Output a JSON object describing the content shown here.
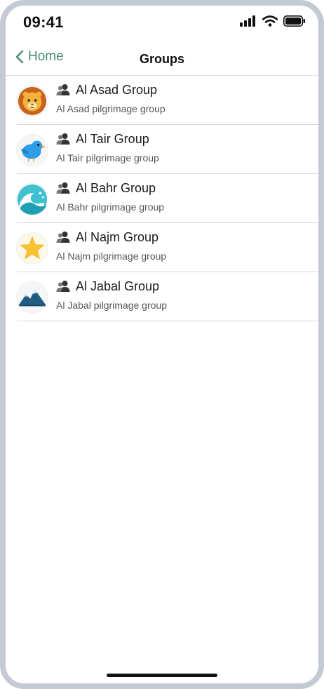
{
  "status_bar": {
    "time": "09:41"
  },
  "nav": {
    "back_label": "Home",
    "title": "Groups"
  },
  "groups": [
    {
      "name": "Al Asad Group",
      "description": "Al Asad pilgrimage group",
      "avatar": "lion-icon"
    },
    {
      "name": "Al Tair Group",
      "description": "Al Tair pilgrimage group",
      "avatar": "bird-icon"
    },
    {
      "name": "Al Bahr Group",
      "description": "Al Bahr pilgrimage group",
      "avatar": "wave-icon"
    },
    {
      "name": "Al Najm Group",
      "description": "Al Najm pilgrimage group",
      "avatar": "star-icon"
    },
    {
      "name": "Al Jabal Group",
      "description": "Al Jabal pilgrimage group",
      "avatar": "mountain-icon"
    }
  ],
  "colors": {
    "accent": "#4d8b78",
    "frame": "#c3cad3",
    "divider": "#d8d8d8"
  }
}
